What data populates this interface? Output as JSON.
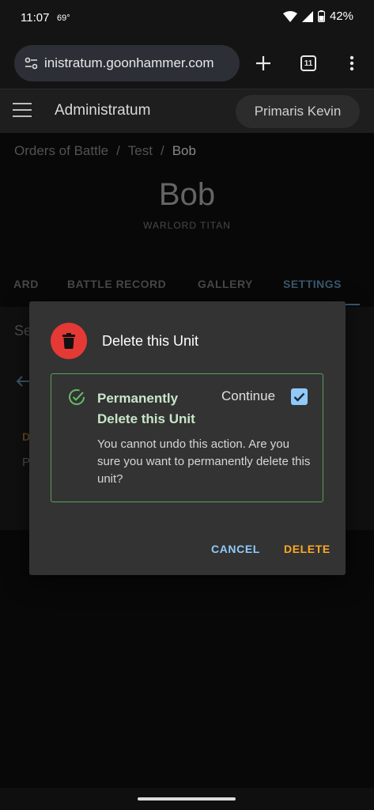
{
  "status_bar": {
    "time": "11:07",
    "temperature": "69°",
    "battery": "42%"
  },
  "browser": {
    "url": "inistratum.goonhammer.com",
    "tab_count": "11"
  },
  "app": {
    "title": "Administratum",
    "user": "Primaris Kevin"
  },
  "breadcrumb": {
    "items": [
      "Orders of Battle",
      "Test",
      "Bob"
    ],
    "separator": "/"
  },
  "unit": {
    "name": "Bob",
    "type": "WARLORD TITAN"
  },
  "tabs": [
    "ARD",
    "BATTLE RECORD",
    "GALLERY",
    "SETTINGS"
  ],
  "background_fragments": {
    "settings_heading": "Se",
    "d_letter": "D",
    "p_letter": "P"
  },
  "dialog": {
    "title": "Delete this Unit",
    "confirm_title": "Permanently Delete this Unit",
    "continue_label": "Continue",
    "checked": true,
    "description": "You cannot undo this action. Are you sure you want to permanently delete this unit?",
    "cancel_label": "CANCEL",
    "delete_label": "DELETE"
  },
  "colors": {
    "danger": "#e53935",
    "confirm_border": "#5f9e5f",
    "cancel": "#90caf9",
    "delete": "#ffa726",
    "accent": "#5b86a6"
  }
}
